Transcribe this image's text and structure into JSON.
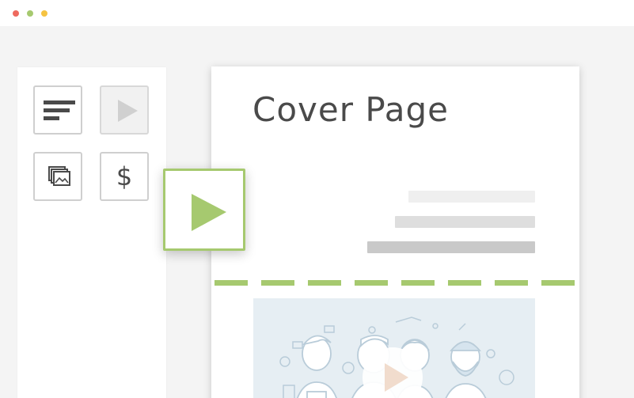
{
  "window": {
    "traffic_lights": [
      {
        "name": "close",
        "color": "#ee6a5f"
      },
      {
        "name": "minimize",
        "color": "#a6c96f"
      },
      {
        "name": "zoom",
        "color": "#f5c342"
      }
    ]
  },
  "sidebar": {
    "blocks": [
      {
        "name": "text-block",
        "icon": "text-lines-icon",
        "state": "enabled"
      },
      {
        "name": "video-block",
        "icon": "play-icon",
        "state": "dragging"
      },
      {
        "name": "image-block",
        "icon": "image-gallery-icon",
        "state": "enabled"
      },
      {
        "name": "pricing-block",
        "icon": "dollar-icon",
        "label": "$",
        "state": "enabled"
      }
    ]
  },
  "drag_preview": {
    "icon": "play-icon",
    "accent_color": "#a6c96f"
  },
  "page": {
    "title": "Cover Page",
    "placeholder_lines": [
      "light",
      "medium",
      "dark"
    ],
    "drop_indicator_color": "#a6c96f",
    "video": {
      "icon": "play-icon",
      "illustration": "team-illustration"
    }
  }
}
